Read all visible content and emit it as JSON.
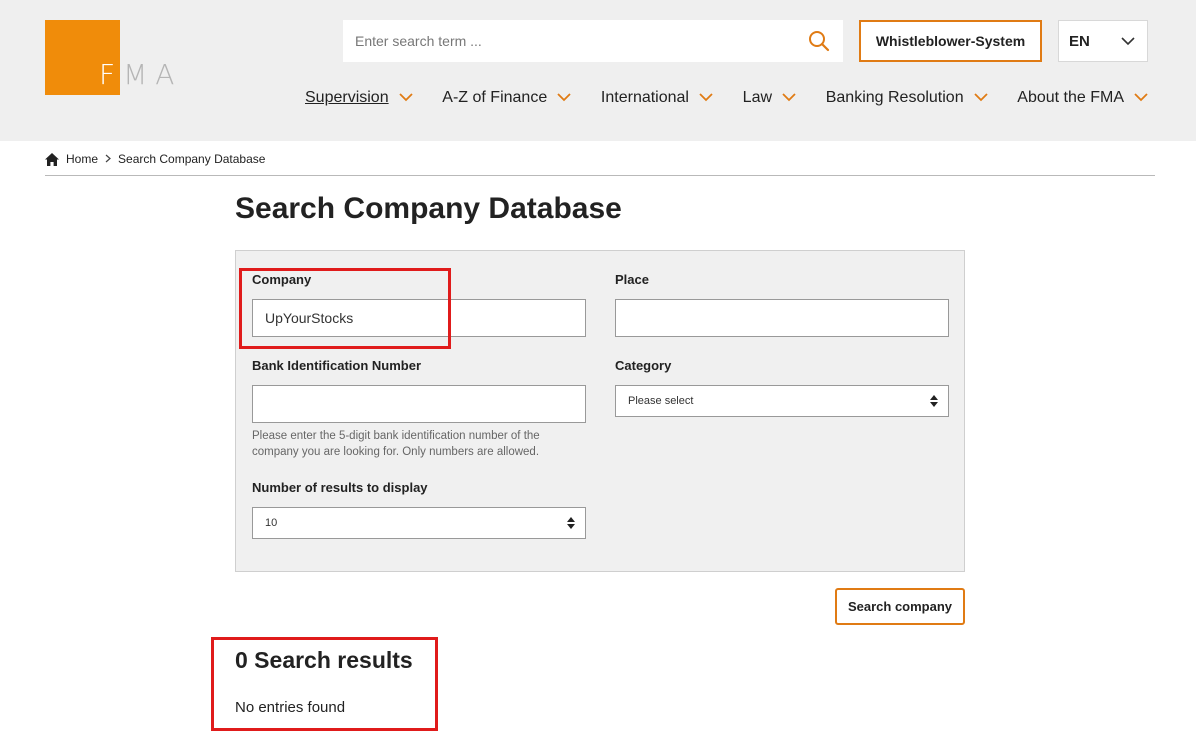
{
  "header": {
    "logo_text_f": "F",
    "logo_text_rest": "MA",
    "search_placeholder": "Enter search term ...",
    "whistleblower_label": "Whistleblower-System",
    "language": "EN",
    "accent_color": "#e07b14",
    "nav": [
      {
        "label": "Supervision",
        "active": true
      },
      {
        "label": "A-Z of Finance",
        "active": false
      },
      {
        "label": "International",
        "active": false
      },
      {
        "label": "Law",
        "active": false
      },
      {
        "label": "Banking Resolution",
        "active": false
      },
      {
        "label": "About the FMA",
        "active": false
      }
    ]
  },
  "breadcrumb": {
    "home": "Home",
    "current": "Search Company Database"
  },
  "page": {
    "title": "Search Company Database"
  },
  "form": {
    "company_label": "Company",
    "company_value": "UpYourStocks",
    "place_label": "Place",
    "place_value": "",
    "bin_label": "Bank Identification Number",
    "bin_value": "",
    "bin_hint_line1": "Please enter the 5-digit bank identification number of the",
    "bin_hint_line2": "company you are looking for. Only numbers are allowed.",
    "category_label": "Category",
    "category_value": "Please select",
    "results_count_label": "Number of results to display",
    "results_count_value": "10",
    "search_button": "Search company"
  },
  "results": {
    "title": "0 Search results",
    "message": "No entries found"
  },
  "annotation_color": "#e01b1b"
}
